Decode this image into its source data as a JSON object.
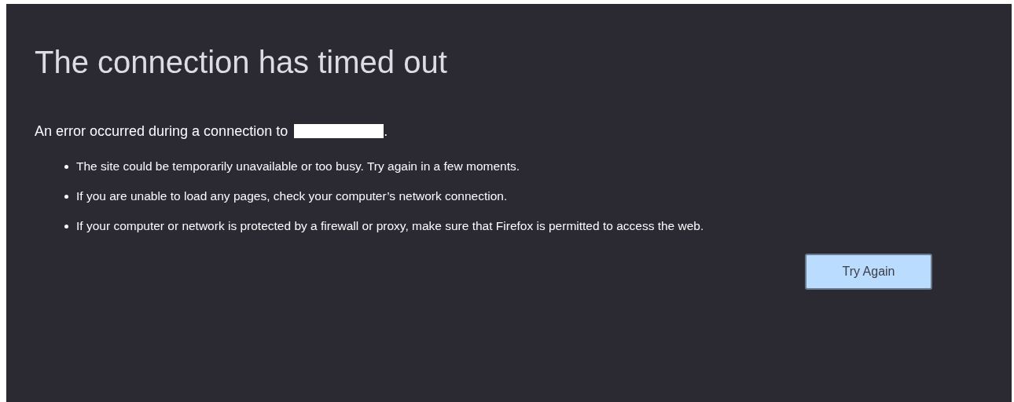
{
  "title": "The connection has timed out",
  "intro": {
    "text": "An error occurred during a connection to",
    "end": "."
  },
  "reasons": [
    "The site could be temporarily unavailable or too busy. Try again in a few moments.",
    "If you are unable to load any pages, check your computer’s network connection.",
    "If your computer or network is protected by a firewall or proxy, make sure that Firefox is permitted to access the web."
  ],
  "button": "Try Again"
}
